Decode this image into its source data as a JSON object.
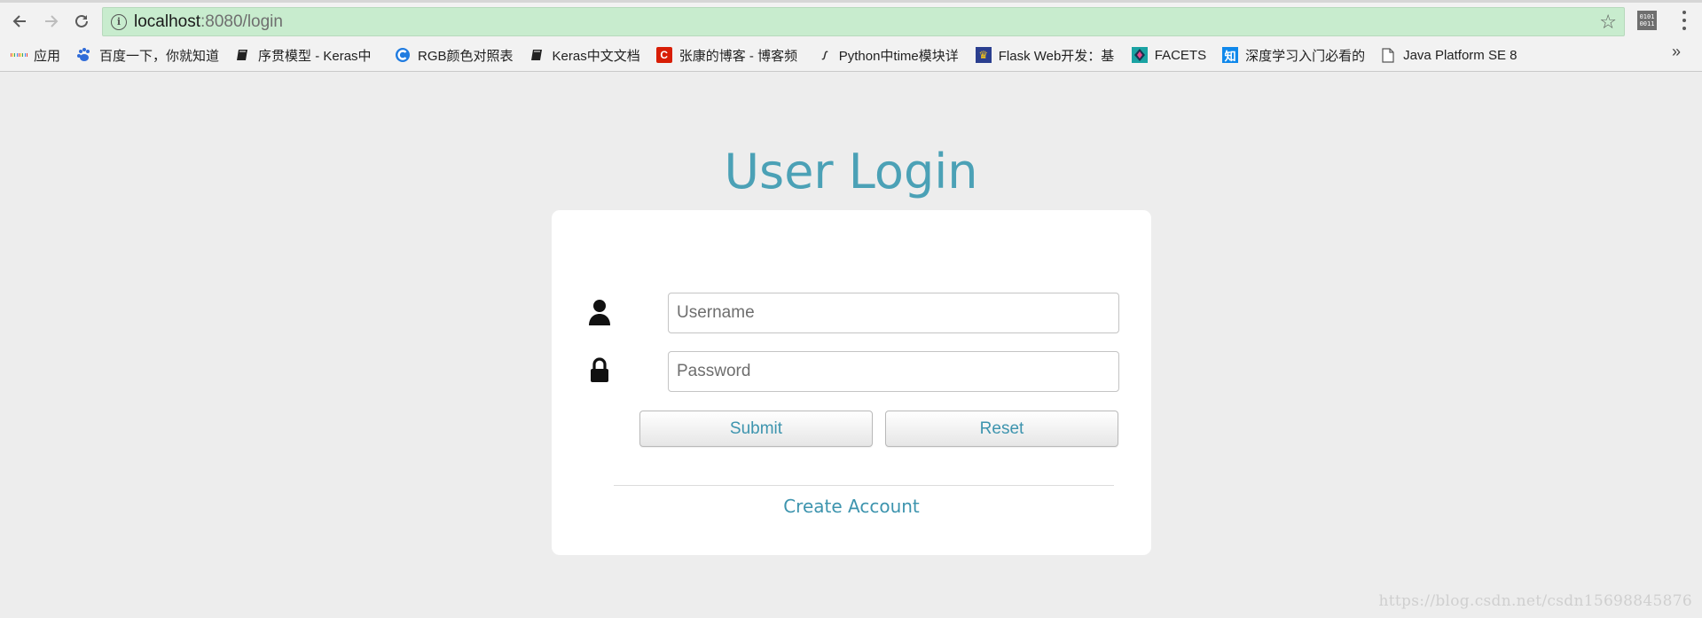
{
  "browser": {
    "url_host": "localhost",
    "url_path": ":8080/login",
    "bookmarks": [
      {
        "label": "应用",
        "icon": "apps-grid-icon"
      },
      {
        "label": "百度一下，你就知道",
        "icon": "baidu-paw-icon"
      },
      {
        "label": "序贯模型 - Keras中",
        "icon": "book-icon"
      },
      {
        "label": "RGB颜色对照表",
        "icon": "c-logo-icon"
      },
      {
        "label": "Keras中文文档",
        "icon": "book-icon"
      },
      {
        "label": "张康的博客 - 博客频",
        "icon": "csdn-c-icon"
      },
      {
        "label": "Python中time模块详",
        "icon": "script-icon"
      },
      {
        "label": "Flask Web开发：基",
        "icon": "flask-book-icon"
      },
      {
        "label": "FACETS",
        "icon": "diamond-icon"
      },
      {
        "label": "深度学习入门必看的",
        "icon": "zhihu-icon"
      },
      {
        "label": "Java Platform SE 8",
        "icon": "page-icon"
      }
    ],
    "more_bookmarks": "»"
  },
  "login": {
    "title": "User Login",
    "username_placeholder": "Username",
    "password_placeholder": "Password",
    "submit_label": "Submit",
    "reset_label": "Reset",
    "create_account_label": "Create Account"
  },
  "watermark": "https://blog.csdn.net/csdn15698845876",
  "colors": {
    "accent": "#4ba1b6",
    "link": "#3d94ae",
    "omnibox": "#c8ecce",
    "page_background": "#ededed",
    "card": "#ffffff"
  }
}
